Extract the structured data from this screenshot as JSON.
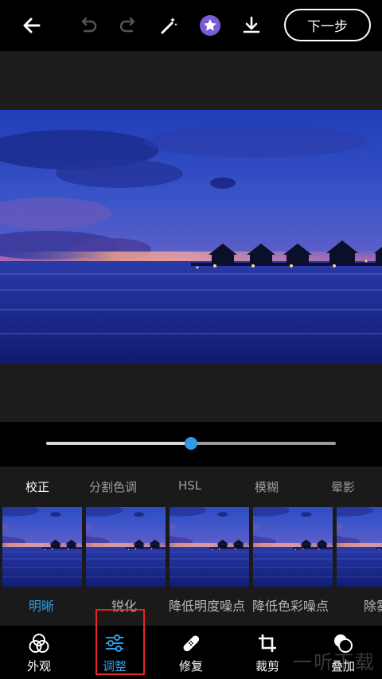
{
  "toolbar": {
    "back_icon": "arrow-left-icon",
    "undo_icon": "undo-icon",
    "redo_icon": "redo-icon",
    "magic_icon": "magic-wand-icon",
    "favorite_icon": "star-badge-icon",
    "download_icon": "download-icon",
    "next_label": "下一步"
  },
  "slider": {
    "value": 0.5
  },
  "subtabs": [
    {
      "label": "校正",
      "active": true
    },
    {
      "label": "分割色调",
      "active": false
    },
    {
      "label": "HSL",
      "active": false
    },
    {
      "label": "模糊",
      "active": false
    },
    {
      "label": "晕影",
      "active": false
    }
  ],
  "filters": [
    {
      "label": "明晰",
      "active": true
    },
    {
      "label": "锐化",
      "active": false
    },
    {
      "label": "降低明度噪点",
      "active": false
    },
    {
      "label": "降低色彩噪点",
      "active": false
    },
    {
      "label": "除雾",
      "active": false
    }
  ],
  "bottom_nav": [
    {
      "label": "外观",
      "icon": "looks-circles-icon",
      "active": false
    },
    {
      "label": "调整",
      "icon": "sliders-icon",
      "active": true
    },
    {
      "label": "修复",
      "icon": "bandage-icon",
      "active": false
    },
    {
      "label": "裁剪",
      "icon": "crop-icon",
      "active": false
    },
    {
      "label": "叠加",
      "icon": "overlay-icon",
      "active": false
    }
  ],
  "watermark": "一听下载",
  "colors": {
    "accent": "#2e9be2",
    "highlight_box": "#e22222",
    "panel_bg": "#1a1a1a"
  }
}
